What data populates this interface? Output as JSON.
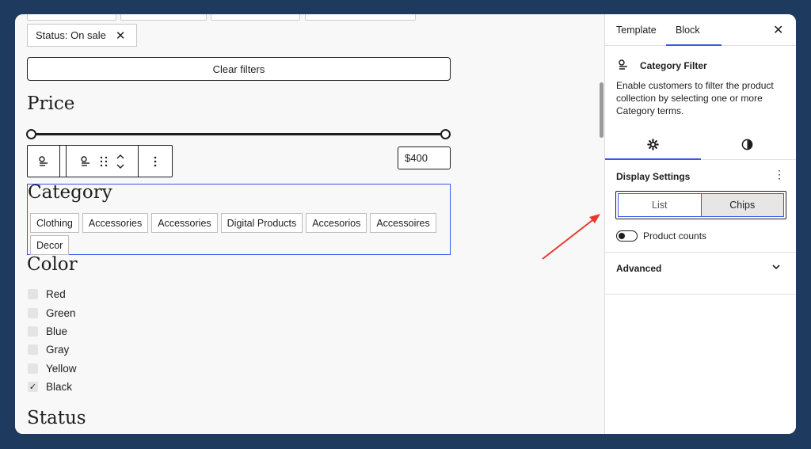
{
  "editor": {
    "status_chip": "Status: On sale",
    "status_chip_close": "✕",
    "clear_button": "Clear filters",
    "price_heading": "Price",
    "price_max": "$400",
    "category_heading": "Category",
    "categories": [
      "Clothing",
      "Accessories",
      "Accessories",
      "Digital Products",
      "Accesorios",
      "Accessoires",
      "Decor"
    ],
    "color_heading": "Color",
    "colors": [
      {
        "label": "Red",
        "checked": false
      },
      {
        "label": "Green",
        "checked": false
      },
      {
        "label": "Blue",
        "checked": false
      },
      {
        "label": "Gray",
        "checked": false
      },
      {
        "label": "Yellow",
        "checked": false
      },
      {
        "label": "Black",
        "checked": true
      }
    ],
    "status_heading": "Status"
  },
  "sidebar": {
    "tabs": [
      "Template",
      "Block"
    ],
    "active_tab": "Block",
    "block_title": "Category Filter",
    "block_description": "Enable customers to filter the product collection by selecting one or more Category terms.",
    "section_title": "Display Settings",
    "display_options": [
      "List",
      "Chips"
    ],
    "selected_display": "Chips",
    "toggle_label": "Product counts",
    "toggle_on": false,
    "advanced_label": "Advanced"
  },
  "colors": {
    "accent": "#3858e9",
    "annotation_arrow": "#e8392b",
    "frame_background": "#1e3a5f"
  }
}
